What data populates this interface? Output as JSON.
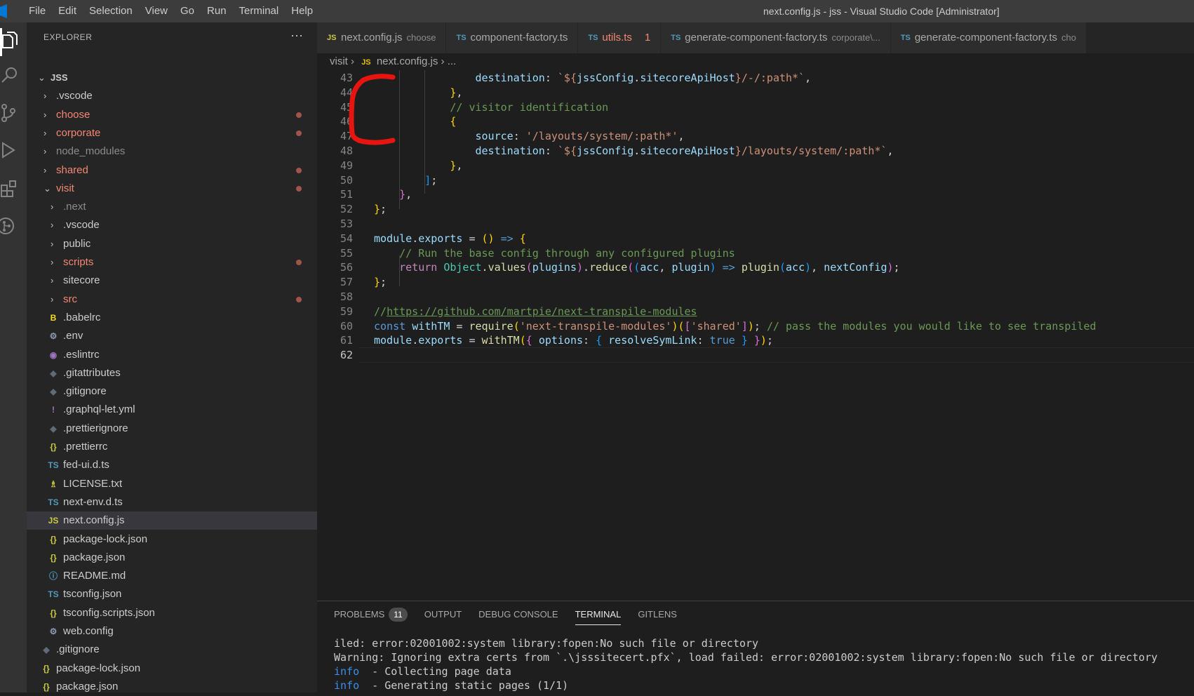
{
  "menu": [
    "File",
    "Edit",
    "Selection",
    "View",
    "Go",
    "Run",
    "Terminal",
    "Help"
  ],
  "window_title": "next.config.js - jss - Visual Studio Code [Administrator]",
  "explorer": {
    "header": "EXPLORER",
    "more": "···",
    "root": "JSS",
    "items": [
      {
        "label": "JSS",
        "type": "folder-open",
        "color": "#cccccc"
      },
      {
        "label": ".vscode",
        "type": "folder",
        "color": "#cccccc"
      },
      {
        "label": "choose",
        "type": "folder",
        "color": "#f48771",
        "modified": true
      },
      {
        "label": "corporate",
        "type": "folder",
        "color": "#f48771",
        "modified": true
      },
      {
        "label": "node_modules",
        "type": "folder",
        "color": "#8b8b8b"
      },
      {
        "label": "shared",
        "type": "folder",
        "color": "#f48771",
        "modified": true
      },
      {
        "label": "visit",
        "type": "folder-open",
        "color": "#f48771",
        "modified": true
      },
      {
        "label": ".next",
        "type": "folder",
        "color": "#8b8b8b"
      },
      {
        "label": ".vscode",
        "type": "folder",
        "color": "#cccccc"
      },
      {
        "label": "public",
        "type": "folder",
        "color": "#cccccc"
      },
      {
        "label": "scripts",
        "type": "folder",
        "color": "#f48771",
        "modified": true
      },
      {
        "label": "sitecore",
        "type": "folder",
        "color": "#cccccc"
      },
      {
        "label": "src",
        "type": "folder",
        "color": "#f48771",
        "modified": true
      },
      {
        "label": ".babelrc",
        "type": "file",
        "icon": "B",
        "icon_color": "#f5de19",
        "color": "#cccccc"
      },
      {
        "label": ".env",
        "type": "file",
        "icon": "⚙",
        "icon_color": "#8b9bb0",
        "color": "#cccccc"
      },
      {
        "label": ".eslintrc",
        "type": "file",
        "icon": "◉",
        "icon_color": "#a074c4",
        "color": "#cccccc"
      },
      {
        "label": ".gitattributes",
        "type": "file",
        "icon": "◆",
        "icon_color": "#5f6b78",
        "color": "#cccccc"
      },
      {
        "label": ".gitignore",
        "type": "file",
        "icon": "◆",
        "icon_color": "#5f6b78",
        "color": "#cccccc"
      },
      {
        "label": ".graphql-let.yml",
        "type": "file",
        "icon": "!",
        "icon_color": "#a074c4",
        "color": "#cccccc"
      },
      {
        "label": ".prettierignore",
        "type": "file",
        "icon": "◆",
        "icon_color": "#5f6b78",
        "color": "#cccccc"
      },
      {
        "label": ".prettierrc",
        "type": "file",
        "icon": "{}",
        "icon_color": "#cbcb41",
        "color": "#cccccc"
      },
      {
        "label": "fed-ui.d.ts",
        "type": "file",
        "icon": "TS",
        "icon_color": "#519aba",
        "color": "#cccccc"
      },
      {
        "label": "LICENSE.txt",
        "type": "file",
        "icon": "♗",
        "icon_color": "#cbcb41",
        "color": "#cccccc"
      },
      {
        "label": "next-env.d.ts",
        "type": "file",
        "icon": "TS",
        "icon_color": "#519aba",
        "color": "#cccccc"
      },
      {
        "label": "next.config.js",
        "type": "file",
        "icon": "JS",
        "icon_color": "#cbcb41",
        "color": "#cccccc",
        "selected": true
      },
      {
        "label": "package-lock.json",
        "type": "file",
        "icon": "{}",
        "icon_color": "#cbcb41",
        "color": "#cccccc"
      },
      {
        "label": "package.json",
        "type": "file",
        "icon": "{}",
        "icon_color": "#cbcb41",
        "color": "#cccccc"
      },
      {
        "label": "README.md",
        "type": "file",
        "icon": "ⓘ",
        "icon_color": "#519aba",
        "color": "#cccccc"
      },
      {
        "label": "tsconfig.json",
        "type": "file",
        "icon": "TS",
        "icon_color": "#519aba",
        "color": "#cccccc"
      },
      {
        "label": "tsconfig.scripts.json",
        "type": "file",
        "icon": "{}",
        "icon_color": "#cbcb41",
        "color": "#cccccc"
      },
      {
        "label": "web.config",
        "type": "file",
        "icon": "⚙",
        "icon_color": "#8b9bb0",
        "color": "#cccccc"
      },
      {
        "label": ".gitignore",
        "type": "file",
        "icon": "◆",
        "icon_color": "#5f6b78",
        "color": "#cccccc"
      },
      {
        "label": "package-lock.json",
        "type": "file",
        "icon": "{}",
        "icon_color": "#cbcb41",
        "color": "#cccccc"
      },
      {
        "label": "package.json",
        "type": "file",
        "icon": "{}",
        "icon_color": "#cbcb41",
        "color": "#cccccc"
      }
    ]
  },
  "tabs": [
    {
      "icon": "JS",
      "icon_color": "#cbcb41",
      "label": "next.config.js",
      "desc": "choose",
      "active": false,
      "label_color": "#a9a9a9"
    },
    {
      "icon": "TS",
      "icon_color": "#519aba",
      "label": "component-factory.ts",
      "desc": "",
      "active": false,
      "label_color": "#a9a9a9"
    },
    {
      "icon": "TS",
      "icon_color": "#519aba",
      "label": "utils.ts",
      "desc": "",
      "count": "1",
      "active": false,
      "label_color": "#f48771"
    },
    {
      "icon": "TS",
      "icon_color": "#519aba",
      "label": "generate-component-factory.ts",
      "desc": "corporate\\...",
      "active": false,
      "label_color": "#a9a9a9"
    },
    {
      "icon": "TS",
      "icon_color": "#519aba",
      "label": "generate-component-factory.ts",
      "desc": "cho",
      "active": false,
      "label_color": "#a9a9a9"
    }
  ],
  "breadcrumb": {
    "folder": "visit",
    "icon": "JS",
    "file": "next.config.js",
    "rest": "..."
  },
  "code_lines": [
    {
      "n": "43",
      "tokens": [
        [
          "                ",
          "t-plain"
        ],
        [
          "destination",
          "t-prop"
        ],
        [
          ": ",
          "t-plain"
        ],
        [
          "`${",
          "t-str"
        ],
        [
          "jssConfig",
          "t-prop"
        ],
        [
          ".",
          "t-plain"
        ],
        [
          "sitecoreApiHost",
          "t-prop"
        ],
        [
          "}",
          "t-str"
        ],
        [
          "/-/:path*`",
          "t-str"
        ],
        [
          ",",
          "t-plain"
        ]
      ]
    },
    {
      "n": "44",
      "tokens": [
        [
          "            ",
          "t-plain"
        ],
        [
          "}",
          "t-b1"
        ],
        [
          ",",
          "t-plain"
        ]
      ]
    },
    {
      "n": "45",
      "tokens": [
        [
          "            ",
          "t-plain"
        ],
        [
          "// visitor identification",
          "t-com"
        ]
      ]
    },
    {
      "n": "46",
      "tokens": [
        [
          "            ",
          "t-plain"
        ],
        [
          "{",
          "t-b1"
        ]
      ]
    },
    {
      "n": "47",
      "tokens": [
        [
          "                ",
          "t-plain"
        ],
        [
          "source",
          "t-prop"
        ],
        [
          ": ",
          "t-plain"
        ],
        [
          "'/layouts/system/:path*'",
          "t-str"
        ],
        [
          ",",
          "t-plain"
        ]
      ]
    },
    {
      "n": "48",
      "tokens": [
        [
          "                ",
          "t-plain"
        ],
        [
          "destination",
          "t-prop"
        ],
        [
          ": ",
          "t-plain"
        ],
        [
          "`${",
          "t-str"
        ],
        [
          "jssConfig",
          "t-prop"
        ],
        [
          ".",
          "t-plain"
        ],
        [
          "sitecoreApiHost",
          "t-prop"
        ],
        [
          "}",
          "t-str"
        ],
        [
          "/layouts/system/:path*`",
          "t-str"
        ],
        [
          ",",
          "t-plain"
        ]
      ]
    },
    {
      "n": "49",
      "tokens": [
        [
          "            ",
          "t-plain"
        ],
        [
          "}",
          "t-b1"
        ],
        [
          ",",
          "t-plain"
        ]
      ]
    },
    {
      "n": "50",
      "tokens": [
        [
          "        ",
          "t-plain"
        ],
        [
          "]",
          "t-b3"
        ],
        [
          ";",
          "t-plain"
        ]
      ]
    },
    {
      "n": "51",
      "tokens": [
        [
          "    ",
          "t-plain"
        ],
        [
          "}",
          "t-b2"
        ],
        [
          ",",
          "t-plain"
        ]
      ]
    },
    {
      "n": "52",
      "tokens": [
        [
          "}",
          "t-b1"
        ],
        [
          ";",
          "t-plain"
        ]
      ]
    },
    {
      "n": "53",
      "tokens": []
    },
    {
      "n": "54",
      "tokens": [
        [
          "module",
          "t-prop"
        ],
        [
          ".",
          "t-plain"
        ],
        [
          "exports",
          "t-prop"
        ],
        [
          " = ",
          "t-plain"
        ],
        [
          "()",
          "t-b1"
        ],
        [
          " ",
          "t-plain"
        ],
        [
          "=>",
          "t-kw"
        ],
        [
          " ",
          "t-plain"
        ],
        [
          "{",
          "t-b1"
        ]
      ]
    },
    {
      "n": "55",
      "tokens": [
        [
          "    ",
          "t-plain"
        ],
        [
          "// Run the base config through any configured plugins",
          "t-com"
        ]
      ]
    },
    {
      "n": "56",
      "tokens": [
        [
          "    ",
          "t-plain"
        ],
        [
          "return",
          "t-kw2"
        ],
        [
          " ",
          "t-plain"
        ],
        [
          "Object",
          "t-cls"
        ],
        [
          ".",
          "t-plain"
        ],
        [
          "values",
          "t-fn"
        ],
        [
          "(",
          "t-b2"
        ],
        [
          "plugins",
          "t-prop"
        ],
        [
          ")",
          "t-b2"
        ],
        [
          ".",
          "t-plain"
        ],
        [
          "reduce",
          "t-fn"
        ],
        [
          "(",
          "t-b2"
        ],
        [
          "(",
          "t-b3"
        ],
        [
          "acc",
          "t-prop"
        ],
        [
          ", ",
          "t-plain"
        ],
        [
          "plugin",
          "t-prop"
        ],
        [
          ")",
          "t-b3"
        ],
        [
          " ",
          "t-plain"
        ],
        [
          "=>",
          "t-kw"
        ],
        [
          " ",
          "t-plain"
        ],
        [
          "plugin",
          "t-fn"
        ],
        [
          "(",
          "t-b3"
        ],
        [
          "acc",
          "t-prop"
        ],
        [
          ")",
          "t-b3"
        ],
        [
          ", ",
          "t-plain"
        ],
        [
          "nextConfig",
          "t-prop"
        ],
        [
          ")",
          "t-b2"
        ],
        [
          ";",
          "t-plain"
        ]
      ]
    },
    {
      "n": "57",
      "tokens": [
        [
          "}",
          "t-b1"
        ],
        [
          ";",
          "t-plain"
        ]
      ]
    },
    {
      "n": "58",
      "tokens": []
    },
    {
      "n": "59",
      "tokens": [
        [
          "//",
          "t-com"
        ],
        [
          "https://github.com/martpie/next-transpile-modules",
          "t-url"
        ]
      ]
    },
    {
      "n": "60",
      "tokens": [
        [
          "const",
          "t-kw"
        ],
        [
          " ",
          "t-plain"
        ],
        [
          "withTM",
          "t-prop"
        ],
        [
          " = ",
          "t-plain"
        ],
        [
          "require",
          "t-fn"
        ],
        [
          "(",
          "t-b1"
        ],
        [
          "'next-transpile-modules'",
          "t-str"
        ],
        [
          ")",
          "t-b1"
        ],
        [
          "(",
          "t-b1"
        ],
        [
          "[",
          "t-b2"
        ],
        [
          "'shared'",
          "t-str"
        ],
        [
          "]",
          "t-b2"
        ],
        [
          ")",
          "t-b1"
        ],
        [
          "; ",
          "t-plain"
        ],
        [
          "// pass the modules you would like to see transpiled",
          "t-com"
        ]
      ]
    },
    {
      "n": "61",
      "tokens": [
        [
          "module",
          "t-prop"
        ],
        [
          ".",
          "t-plain"
        ],
        [
          "exports",
          "t-prop"
        ],
        [
          " = ",
          "t-plain"
        ],
        [
          "withTM",
          "t-fn"
        ],
        [
          "(",
          "t-b1"
        ],
        [
          "{",
          "t-b2"
        ],
        [
          " ",
          "t-plain"
        ],
        [
          "options",
          "t-prop"
        ],
        [
          ": ",
          "t-plain"
        ],
        [
          "{",
          "t-b3"
        ],
        [
          " ",
          "t-plain"
        ],
        [
          "resolveSymLink",
          "t-prop"
        ],
        [
          ": ",
          "t-plain"
        ],
        [
          "true",
          "t-kw"
        ],
        [
          " ",
          "t-plain"
        ],
        [
          "}",
          "t-b3"
        ],
        [
          " ",
          "t-plain"
        ],
        [
          "}",
          "t-b2"
        ],
        [
          ")",
          "t-b1"
        ],
        [
          ";",
          "t-plain"
        ]
      ]
    },
    {
      "n": "62",
      "tokens": [],
      "current": true
    }
  ],
  "panel": {
    "tabs": [
      {
        "label": "PROBLEMS",
        "badge": "11",
        "active": false
      },
      {
        "label": "OUTPUT",
        "active": false
      },
      {
        "label": "DEBUG CONSOLE",
        "active": false
      },
      {
        "label": "TERMINAL",
        "active": true
      },
      {
        "label": "GITLENS",
        "active": false
      }
    ],
    "terminal_lines": [
      {
        "prefix": "",
        "text": "iled: error:02001002:system library:fopen:No such file or directory"
      },
      {
        "prefix": "",
        "text": "Warning: Ignoring extra certs from `.\\jsssitecert.pfx`, load failed: error:02001002:system library:fopen:No such file or directory"
      },
      {
        "prefix": "info",
        "text": "  - Collecting page data"
      },
      {
        "prefix": "info",
        "text": "  - Generating static pages (1/1)"
      }
    ]
  },
  "annotation_color": "#e8140f"
}
